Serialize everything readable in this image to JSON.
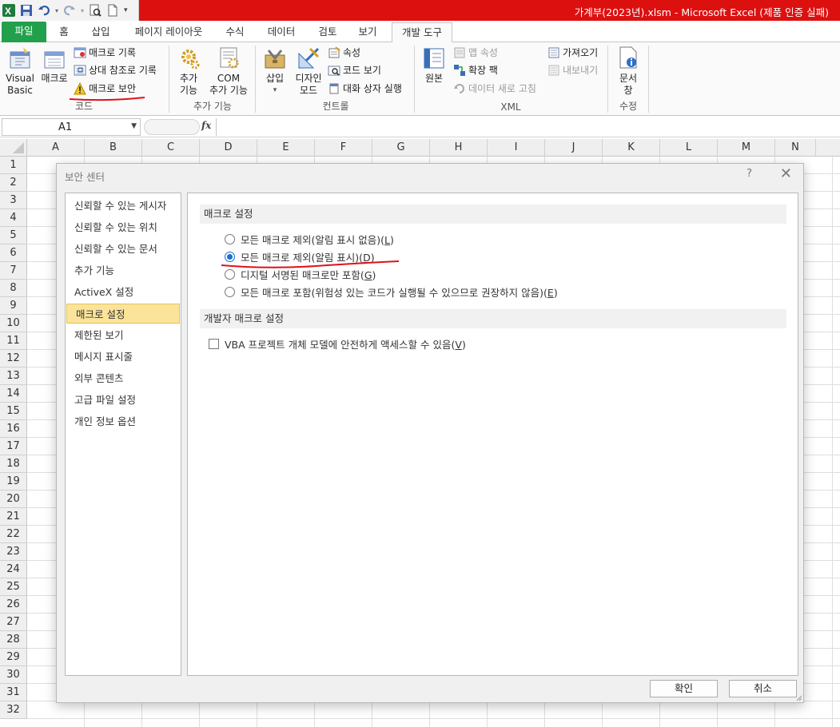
{
  "window": {
    "title": "가계부(2023년).xlsm  -  Microsoft Excel (제품 인증 실패)"
  },
  "ribbon": {
    "tabs": [
      {
        "label": "파일"
      },
      {
        "label": "홈"
      },
      {
        "label": "삽입"
      },
      {
        "label": "페이지 레이아웃"
      },
      {
        "label": "수식"
      },
      {
        "label": "데이터"
      },
      {
        "label": "검토"
      },
      {
        "label": "보기"
      },
      {
        "label": "개발 도구"
      }
    ],
    "active_tab": "개발 도구",
    "code": {
      "visual_basic_line1": "Visual",
      "visual_basic_line2": "Basic",
      "macro": "매크로",
      "record_macro": "매크로 기록",
      "relative_ref": "상대 참조로 기록",
      "macro_security": "매크로 보안",
      "group_label": "코드"
    },
    "addins": {
      "addins_line1": "추가",
      "addins_line2": "기능",
      "com_line1": "COM",
      "com_line2": "추가 기능",
      "group_label": "추가 기능"
    },
    "controls": {
      "insert": "삽입",
      "design_line1": "디자인",
      "design_line2": "모드",
      "properties": "속성",
      "view_code": "코드 보기",
      "run_dialog": "대화 상자 실행",
      "group_label": "컨트롤"
    },
    "xml": {
      "source": "원본",
      "map_properties": "맵 속성",
      "expansion_packs": "확장 팩",
      "refresh_data": "데이터 새로 고침",
      "import": "가져오기",
      "export": "내보내기",
      "group_label": "XML"
    },
    "modify": {
      "doc_panel_line1": "문서",
      "doc_panel_line2": "창",
      "group_label": "수정"
    }
  },
  "formula_bar": {
    "name_box": "A1",
    "fx": "fx",
    "value": ""
  },
  "sheet": {
    "columns": [
      "A",
      "B",
      "C",
      "D",
      "E",
      "F",
      "G",
      "H",
      "I",
      "J",
      "K",
      "L",
      "M",
      "N"
    ],
    "rows": [
      "1",
      "2",
      "3",
      "4",
      "5",
      "6",
      "7",
      "8",
      "9",
      "10",
      "11",
      "12",
      "13",
      "14",
      "15",
      "16",
      "17",
      "18",
      "19",
      "20",
      "21",
      "22",
      "23",
      "24",
      "25",
      "26",
      "27",
      "28",
      "29",
      "30",
      "31",
      "32"
    ]
  },
  "dialog": {
    "title": "보안 센터",
    "help": "?",
    "close": "✕",
    "nav": [
      {
        "label": "신뢰할 수 있는 게시자"
      },
      {
        "label": "신뢰할 수 있는 위치"
      },
      {
        "label": "신뢰할 수 있는 문서"
      },
      {
        "label": "추가 기능"
      },
      {
        "label": "ActiveX 설정"
      },
      {
        "label": "매크로 설정"
      },
      {
        "label": "제한된 보기"
      },
      {
        "label": "메시지 표시줄"
      },
      {
        "label": "외부 콘텐츠"
      },
      {
        "label": "고급 파일 설정"
      },
      {
        "label": "개인 정보 옵션"
      }
    ],
    "selected_nav": "매크로 설정",
    "macro_section": {
      "heading": "매크로 설정",
      "options": [
        {
          "label": "모든 매크로 제외(알림 표시 없음)(",
          "key": "L",
          "close": ")",
          "selected": false
        },
        {
          "label": "모든 매크로 제외(알림 표시)(",
          "key": "D",
          "close": ")",
          "selected": true
        },
        {
          "label": "디지털 서명된 매크로만 포함(",
          "key": "G",
          "close": ")",
          "selected": false
        },
        {
          "label": "모든 매크로 포함(위험성 있는 코드가 실행될 수 있으므로 권장하지 않음)(",
          "key": "E",
          "close": ")",
          "selected": false
        }
      ]
    },
    "dev_section": {
      "heading": "개발자 매크로 설정",
      "vba_label": "VBA 프로젝트 개체 모델에 안전하게 액세스할 수 있음(",
      "vba_key": "V",
      "vba_close": ")",
      "vba_checked": false
    },
    "ok": "확인",
    "cancel": "취소"
  },
  "colors": {
    "title_bar": "#dd1010",
    "file_tab": "#22a04b",
    "selected_nav": "#fbe49a",
    "annotation_underline": "#e0101a",
    "radio_selected": "#1a6fc9"
  }
}
